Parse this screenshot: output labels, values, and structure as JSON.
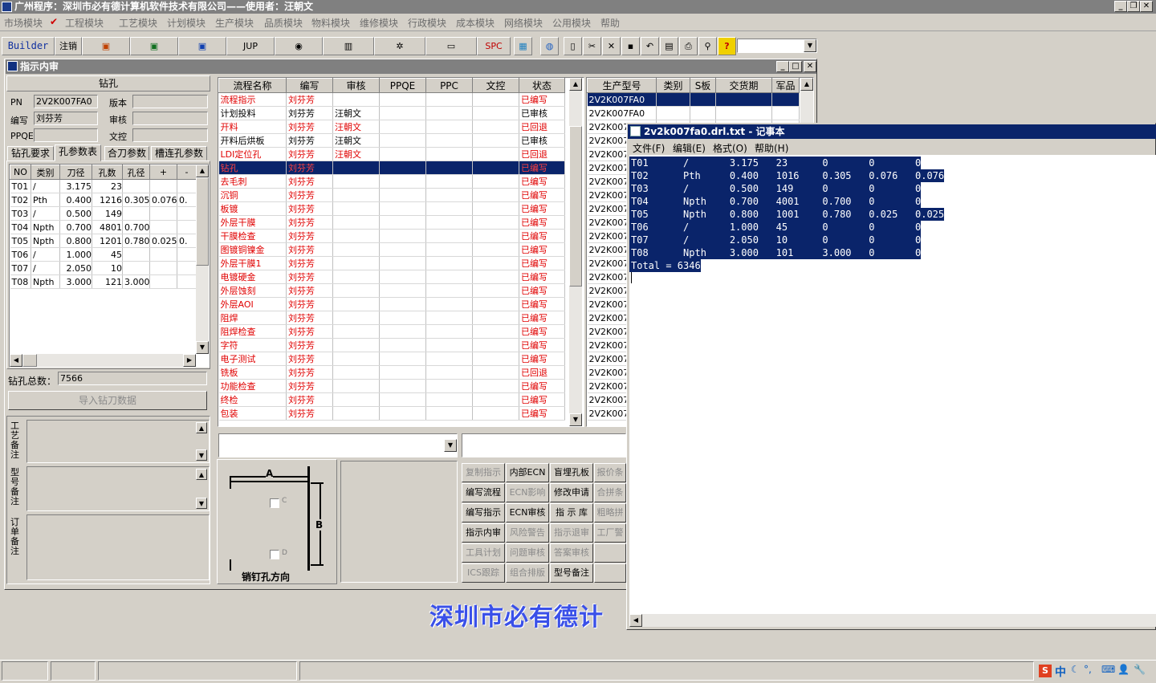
{
  "app": {
    "title": "广州程序：深圳市必有德计算机软件技术有限公司——使用者：汪朝文"
  },
  "menu": [
    "市场模块",
    "工程模块",
    "工艺模块",
    "计划模块",
    "生产模块",
    "品质模块",
    "物料模块",
    "维修模块",
    "行政模块",
    "成本模块",
    "网络模块",
    "公用模块",
    "帮助"
  ],
  "toolbar": {
    "builder": "Builder",
    "logout": "注销",
    "jup": "JUP",
    "spc": "SPC"
  },
  "mdi": {
    "title": "指示内审"
  },
  "left": {
    "section_title": "钻孔",
    "pn_label": "PN",
    "pn_value": "2V2K007FA0",
    "version_label": "版本",
    "version_value": "",
    "writer_label": "编写",
    "writer_value": "刘芬芳",
    "review_label": "审核",
    "review_value": "",
    "ppqe_label": "PPQE",
    "ppqe_value": "",
    "dc_label": "文控",
    "dc_value": "",
    "tabs": [
      "钻孔要求",
      "孔参数表",
      "合刀参数",
      "槽连孔参数"
    ],
    "table_headers": [
      "NO",
      "类别",
      "刀径",
      "孔数",
      "孔径",
      "+",
      "-"
    ],
    "rows": [
      [
        "T01",
        "/",
        "3.175",
        "23",
        "",
        "",
        ""
      ],
      [
        "T02",
        "Pth",
        "0.400",
        "1216",
        "0.305",
        "0.076",
        "0."
      ],
      [
        "T03",
        "/",
        "0.500",
        "149",
        "",
        "",
        ""
      ],
      [
        "T04",
        "Npth",
        "0.700",
        "4801",
        "0.700",
        "",
        ""
      ],
      [
        "T05",
        "Npth",
        "0.800",
        "1201",
        "0.780",
        "0.025",
        "0."
      ],
      [
        "T06",
        "/",
        "1.000",
        "45",
        "",
        "",
        ""
      ],
      [
        "T07",
        "/",
        "2.050",
        "10",
        "",
        "",
        ""
      ],
      [
        "T08",
        "Npth",
        "3.000",
        "121",
        "3.000",
        "",
        ""
      ]
    ],
    "total_label": "钻孔总数：",
    "total_value": "7566",
    "import_button": "导入钻刀数据",
    "notes": [
      "工艺备注",
      "型号备注",
      "订单备注"
    ]
  },
  "flow": {
    "headers": [
      "流程名称",
      "编写",
      "审核",
      "PPQE",
      "PPC",
      "文控",
      "状态"
    ],
    "rows": [
      [
        "流程指示",
        "刘芬芳",
        "",
        "",
        "",
        "",
        "已编写",
        true
      ],
      [
        "计划投料",
        "刘芬芳",
        "汪朝文",
        "",
        "",
        "",
        "已审核",
        false
      ],
      [
        "开料",
        "刘芬芳",
        "汪朝文",
        "",
        "",
        "",
        "已回退",
        true
      ],
      [
        "开料后烘板",
        "刘芬芳",
        "汪朝文",
        "",
        "",
        "",
        "已审核",
        false
      ],
      [
        "LDI定位孔",
        "刘芬芳",
        "汪朝文",
        "",
        "",
        "",
        "已回退",
        true
      ],
      [
        "钻孔",
        "刘芬芳",
        "",
        "",
        "",
        "",
        "已编写",
        true
      ],
      [
        "去毛刺",
        "刘芬芳",
        "",
        "",
        "",
        "",
        "已编写",
        true
      ],
      [
        "沉铜",
        "刘芬芳",
        "",
        "",
        "",
        "",
        "已编写",
        true
      ],
      [
        "板镀",
        "刘芬芳",
        "",
        "",
        "",
        "",
        "已编写",
        true
      ],
      [
        "外层干膜",
        "刘芬芳",
        "",
        "",
        "",
        "",
        "已编写",
        true
      ],
      [
        "干膜检查",
        "刘芬芳",
        "",
        "",
        "",
        "",
        "已编写",
        true
      ],
      [
        "图镀铜镍金",
        "刘芬芳",
        "",
        "",
        "",
        "",
        "已编写",
        true
      ],
      [
        "外层干膜1",
        "刘芬芳",
        "",
        "",
        "",
        "",
        "已编写",
        true
      ],
      [
        "电镀硬金",
        "刘芬芳",
        "",
        "",
        "",
        "",
        "已编写",
        true
      ],
      [
        "外层蚀刻",
        "刘芬芳",
        "",
        "",
        "",
        "",
        "已编写",
        true
      ],
      [
        "外层AOI",
        "刘芬芳",
        "",
        "",
        "",
        "",
        "已编写",
        true
      ],
      [
        "阻焊",
        "刘芬芳",
        "",
        "",
        "",
        "",
        "已编写",
        true
      ],
      [
        "阻焊检查",
        "刘芬芳",
        "",
        "",
        "",
        "",
        "已编写",
        true
      ],
      [
        "字符",
        "刘芬芳",
        "",
        "",
        "",
        "",
        "已编写",
        true
      ],
      [
        "电子测试",
        "刘芬芳",
        "",
        "",
        "",
        "",
        "已编写",
        true
      ],
      [
        "铣板",
        "刘芬芳",
        "",
        "",
        "",
        "",
        "已回退",
        true
      ],
      [
        "功能检查",
        "刘芬芳",
        "",
        "",
        "",
        "",
        "已编写",
        true
      ],
      [
        "终检",
        "刘芬芳",
        "",
        "",
        "",
        "",
        "已编写",
        true
      ],
      [
        "包装",
        "刘芬芳",
        "",
        "",
        "",
        "",
        "已编写",
        true
      ]
    ],
    "selected_index": 5
  },
  "model": {
    "headers": [
      "生产型号",
      "类别",
      "S板",
      "交货期",
      "军品"
    ],
    "rows": [
      "2V2K007FA0",
      "2V2K007FA0",
      "2V2K007I",
      "2V2K007I",
      "2V2K007I",
      "2V2K007I",
      "2V2K007I",
      "2V2K007I",
      "2V2K007I",
      "2V2K007I",
      "2V2K007I",
      "2V2K007I",
      "2V2K007I",
      "2V2K007I",
      "2V2K007I",
      "2V2K007I",
      "2V2K007I",
      "2V2K007I",
      "2V2K007I",
      "2V2K007I",
      "2V2K007I",
      "2V2K007I",
      "2V2K007I",
      "2V2K007I"
    ]
  },
  "diagram": {
    "a": "A",
    "b": "B",
    "c": "C",
    "d": "D",
    "caption": "销钉孔方向"
  },
  "actions": [
    [
      "复制指示",
      false
    ],
    [
      "内部ECN",
      true
    ],
    [
      "盲埋孔板",
      true
    ],
    [
      "报价条",
      false
    ],
    [
      "编写流程",
      true
    ],
    [
      "ECN影响",
      false
    ],
    [
      "修改申请",
      true
    ],
    [
      "合拼条",
      false
    ],
    [
      "编写指示",
      true
    ],
    [
      "ECN审核",
      true
    ],
    [
      "指 示 库",
      true
    ],
    [
      "粗略拼",
      false
    ],
    [
      "指示内审",
      true
    ],
    [
      "风险警告",
      false
    ],
    [
      "指示退审",
      false
    ],
    [
      "工厂警",
      false
    ],
    [
      "工具计划",
      false
    ],
    [
      "问题审核",
      false
    ],
    [
      "答案审核",
      false
    ],
    [
      "",
      false
    ],
    [
      "ICS跟踪",
      false
    ],
    [
      "组合排版",
      false
    ],
    [
      "型号备注",
      true
    ],
    [
      "",
      false
    ]
  ],
  "notepad": {
    "title": "2v2k007fa0.drl.txt - 记事本",
    "menu": [
      "文件(F)",
      "编辑(E)",
      "格式(O)",
      "帮助(H)"
    ],
    "lines": [
      "T01      /       3.175   23      0       0       0",
      "T02      Pth     0.400   1016    0.305   0.076   0.076",
      "T03      /       0.500   149     0       0       0",
      "T04      Npth    0.700   4001    0.700   0       0",
      "T05      Npth    0.800   1001    0.780   0.025   0.025",
      "T06      /       1.000   45      0       0       0",
      "T07      /       2.050   10      0       0       0",
      "T08      Npth    3.000   101     3.000   0       0",
      "Total = 6346"
    ]
  },
  "watermark": "深圳市必有德计",
  "tray": {
    "ime": "中"
  }
}
